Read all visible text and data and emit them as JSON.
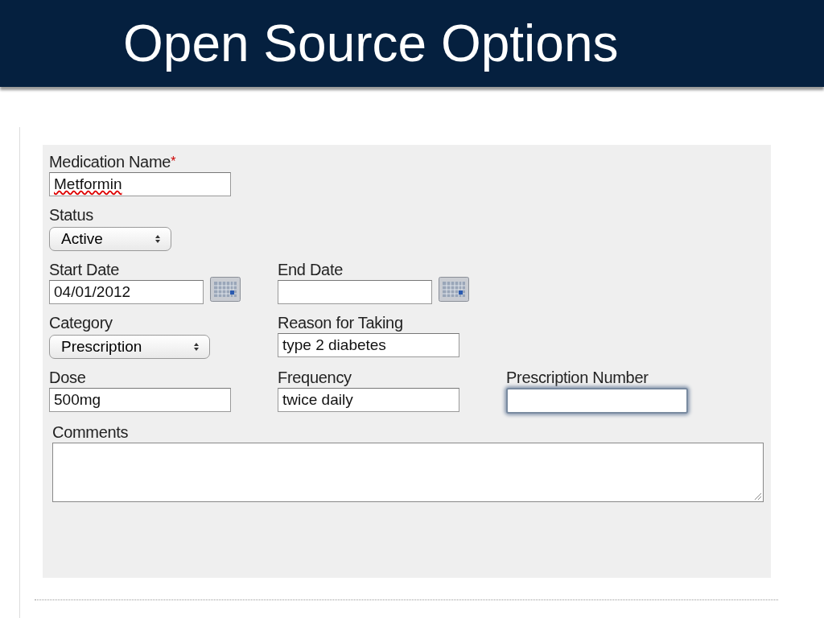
{
  "title": "Open Source Options",
  "form": {
    "required_mark": "*",
    "rows": [
      {
        "fields": [
          {
            "label": "Medication Name",
            "kind": "text",
            "value": "Metformin",
            "required": true,
            "misspelled": true,
            "focused": false
          }
        ]
      },
      {
        "fields": [
          {
            "label": "Status",
            "kind": "select",
            "value": "Active",
            "required": false,
            "misspelled": false,
            "focused": false
          }
        ]
      },
      {
        "fields": [
          {
            "label": "Start Date",
            "kind": "date",
            "value": "04/01/2012",
            "required": false,
            "misspelled": false,
            "focused": false
          },
          {
            "label": "End Date",
            "kind": "date",
            "required": false,
            "focused": false
          }
        ]
      },
      {
        "fields": [
          {
            "label": "Category",
            "kind": "select",
            "value": "Prescription",
            "required": false,
            "misspelled": false,
            "focused": false
          },
          {
            "label": "Reason for Taking",
            "kind": "text",
            "value": "type 2 diabetes",
            "required": false,
            "misspelled": false,
            "focused": false
          }
        ]
      },
      {
        "fields": [
          {
            "label": "Dose",
            "kind": "text",
            "value": "500mg",
            "required": false,
            "misspelled": false,
            "focused": false
          },
          {
            "label": "Frequency",
            "kind": "text",
            "value": "twice daily",
            "required": false,
            "misspelled": false,
            "focused": false
          },
          {
            "label": "Prescription Number",
            "kind": "text",
            "required": false,
            "focused": true
          }
        ]
      },
      {
        "fields": [
          {
            "label": "Comments",
            "kind": "textarea",
            "required": false,
            "focused": false
          }
        ]
      }
    ]
  }
}
